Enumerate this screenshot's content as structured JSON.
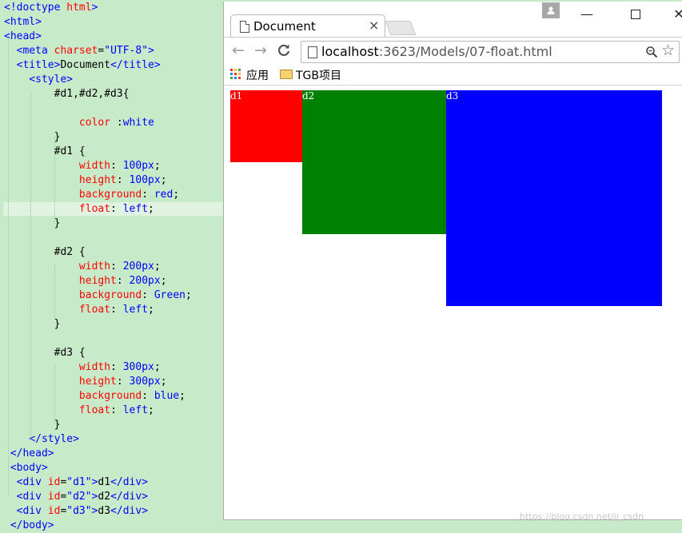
{
  "editor": {
    "lines": [
      [
        [
          "t-tag",
          "<!doctype "
        ],
        [
          "t-attr",
          "html"
        ],
        [
          "t-tag",
          ">"
        ]
      ],
      [
        [
          "t-tag",
          "<html>"
        ]
      ],
      [
        [
          "t-tag",
          "<head>"
        ]
      ],
      [
        [
          "t-txt",
          "  "
        ],
        [
          "t-tag",
          "<meta "
        ],
        [
          "t-attr",
          "charset"
        ],
        [
          "t-txt",
          "="
        ],
        [
          "t-str",
          "\"UTF-8\""
        ],
        [
          "t-tag",
          ">"
        ]
      ],
      [
        [
          "t-txt",
          "  "
        ],
        [
          "t-tag",
          "<title>"
        ],
        [
          "t-txt",
          "Document"
        ],
        [
          "t-tag",
          "</title>"
        ]
      ],
      [
        [
          "t-txt",
          "    "
        ],
        [
          "t-tag",
          "<style>"
        ]
      ],
      [
        [
          "t-txt",
          "        #d1,#d2,#d3{"
        ]
      ],
      [
        [
          "t-txt",
          ""
        ]
      ],
      [
        [
          "t-txt",
          "            "
        ],
        [
          "t-prop",
          "color"
        ],
        [
          "t-txt",
          " :"
        ],
        [
          "t-val",
          "white"
        ]
      ],
      [
        [
          "t-txt",
          "        }"
        ]
      ],
      [
        [
          "t-txt",
          "        #d1 {"
        ]
      ],
      [
        [
          "t-txt",
          "            "
        ],
        [
          "t-prop",
          "width"
        ],
        [
          "t-txt",
          ": "
        ],
        [
          "t-val",
          "100px"
        ],
        [
          "t-txt",
          ";"
        ]
      ],
      [
        [
          "t-txt",
          "            "
        ],
        [
          "t-prop",
          "height"
        ],
        [
          "t-txt",
          ": "
        ],
        [
          "t-val",
          "100px"
        ],
        [
          "t-txt",
          ";"
        ]
      ],
      [
        [
          "t-txt",
          "            "
        ],
        [
          "t-prop",
          "background"
        ],
        [
          "t-txt",
          ": "
        ],
        [
          "t-val",
          "red"
        ],
        [
          "t-txt",
          ";"
        ]
      ],
      [
        [
          "t-txt",
          "            "
        ],
        [
          "t-prop",
          "float"
        ],
        [
          "t-txt",
          ": "
        ],
        [
          "t-val",
          "left"
        ],
        [
          "t-txt",
          ";"
        ]
      ],
      [
        [
          "t-txt",
          "        }"
        ]
      ],
      [
        [
          "t-txt",
          ""
        ]
      ],
      [
        [
          "t-txt",
          "        #d2 {"
        ]
      ],
      [
        [
          "t-txt",
          "            "
        ],
        [
          "t-prop",
          "width"
        ],
        [
          "t-txt",
          ": "
        ],
        [
          "t-val",
          "200px"
        ],
        [
          "t-txt",
          ";"
        ]
      ],
      [
        [
          "t-txt",
          "            "
        ],
        [
          "t-prop",
          "height"
        ],
        [
          "t-txt",
          ": "
        ],
        [
          "t-val",
          "200px"
        ],
        [
          "t-txt",
          ";"
        ]
      ],
      [
        [
          "t-txt",
          "            "
        ],
        [
          "t-prop",
          "background"
        ],
        [
          "t-txt",
          ": "
        ],
        [
          "t-val",
          "Green"
        ],
        [
          "t-txt",
          ";"
        ]
      ],
      [
        [
          "t-txt",
          "            "
        ],
        [
          "t-prop",
          "float"
        ],
        [
          "t-txt",
          ": "
        ],
        [
          "t-val",
          "left"
        ],
        [
          "t-txt",
          ";"
        ]
      ],
      [
        [
          "t-txt",
          "        }"
        ]
      ],
      [
        [
          "t-txt",
          ""
        ]
      ],
      [
        [
          "t-txt",
          "        #d3 {"
        ]
      ],
      [
        [
          "t-txt",
          "            "
        ],
        [
          "t-prop",
          "width"
        ],
        [
          "t-txt",
          ": "
        ],
        [
          "t-val",
          "300px"
        ],
        [
          "t-txt",
          ";"
        ]
      ],
      [
        [
          "t-txt",
          "            "
        ],
        [
          "t-prop",
          "height"
        ],
        [
          "t-txt",
          ": "
        ],
        [
          "t-val",
          "300px"
        ],
        [
          "t-txt",
          ";"
        ]
      ],
      [
        [
          "t-txt",
          "            "
        ],
        [
          "t-prop",
          "background"
        ],
        [
          "t-txt",
          ": "
        ],
        [
          "t-val",
          "blue"
        ],
        [
          "t-txt",
          ";"
        ]
      ],
      [
        [
          "t-txt",
          "            "
        ],
        [
          "t-prop",
          "float"
        ],
        [
          "t-txt",
          ": "
        ],
        [
          "t-val",
          "left"
        ],
        [
          "t-txt",
          ";"
        ]
      ],
      [
        [
          "t-txt",
          "        }"
        ]
      ],
      [
        [
          "t-txt",
          "    "
        ],
        [
          "t-tag",
          "</style>"
        ]
      ],
      [
        [
          "t-txt",
          " "
        ],
        [
          "t-tag",
          "</head>"
        ]
      ],
      [
        [
          "t-txt",
          " "
        ],
        [
          "t-tag",
          "<body>"
        ]
      ],
      [
        [
          "t-txt",
          "  "
        ],
        [
          "t-tag",
          "<div "
        ],
        [
          "t-attr",
          "id"
        ],
        [
          "t-txt",
          "="
        ],
        [
          "t-str",
          "\"d1\""
        ],
        [
          "t-tag",
          ">"
        ],
        [
          "t-txt",
          "d1"
        ],
        [
          "t-tag",
          "</div>"
        ]
      ],
      [
        [
          "t-txt",
          "  "
        ],
        [
          "t-tag",
          "<div "
        ],
        [
          "t-attr",
          "id"
        ],
        [
          "t-txt",
          "="
        ],
        [
          "t-str",
          "\"d2\""
        ],
        [
          "t-tag",
          ">"
        ],
        [
          "t-txt",
          "d2"
        ],
        [
          "t-tag",
          "</div>"
        ]
      ],
      [
        [
          "t-txt",
          "  "
        ],
        [
          "t-tag",
          "<div "
        ],
        [
          "t-attr",
          "id"
        ],
        [
          "t-txt",
          "="
        ],
        [
          "t-str",
          "\"d3\""
        ],
        [
          "t-tag",
          ">"
        ],
        [
          "t-txt",
          "d3"
        ],
        [
          "t-tag",
          "</div>"
        ]
      ],
      [
        [
          "t-txt",
          " "
        ],
        [
          "t-tag",
          "</body>"
        ]
      ]
    ]
  },
  "browser": {
    "tab_title": "Document",
    "tab_close": "×",
    "window_minimize": "—",
    "window_close": "✕",
    "url_host": "localhost",
    "url_rest": ":3623/Models/07-float.html",
    "bookmarks": {
      "apps_label": "应用",
      "folder_label": "TGB项目"
    },
    "boxes": [
      {
        "id": "d1",
        "label": "d1",
        "color": "#ff0000"
      },
      {
        "id": "d2",
        "label": "d2",
        "color": "#008000"
      },
      {
        "id": "d3",
        "label": "d3",
        "color": "#0000ff"
      }
    ]
  },
  "icons": {
    "back": "←",
    "forward": "→",
    "reload": "⟳",
    "zoom": "🔍",
    "star": "☆",
    "profile": "👤"
  },
  "watermark": "https://blog.csdn.net/jj_csdn"
}
